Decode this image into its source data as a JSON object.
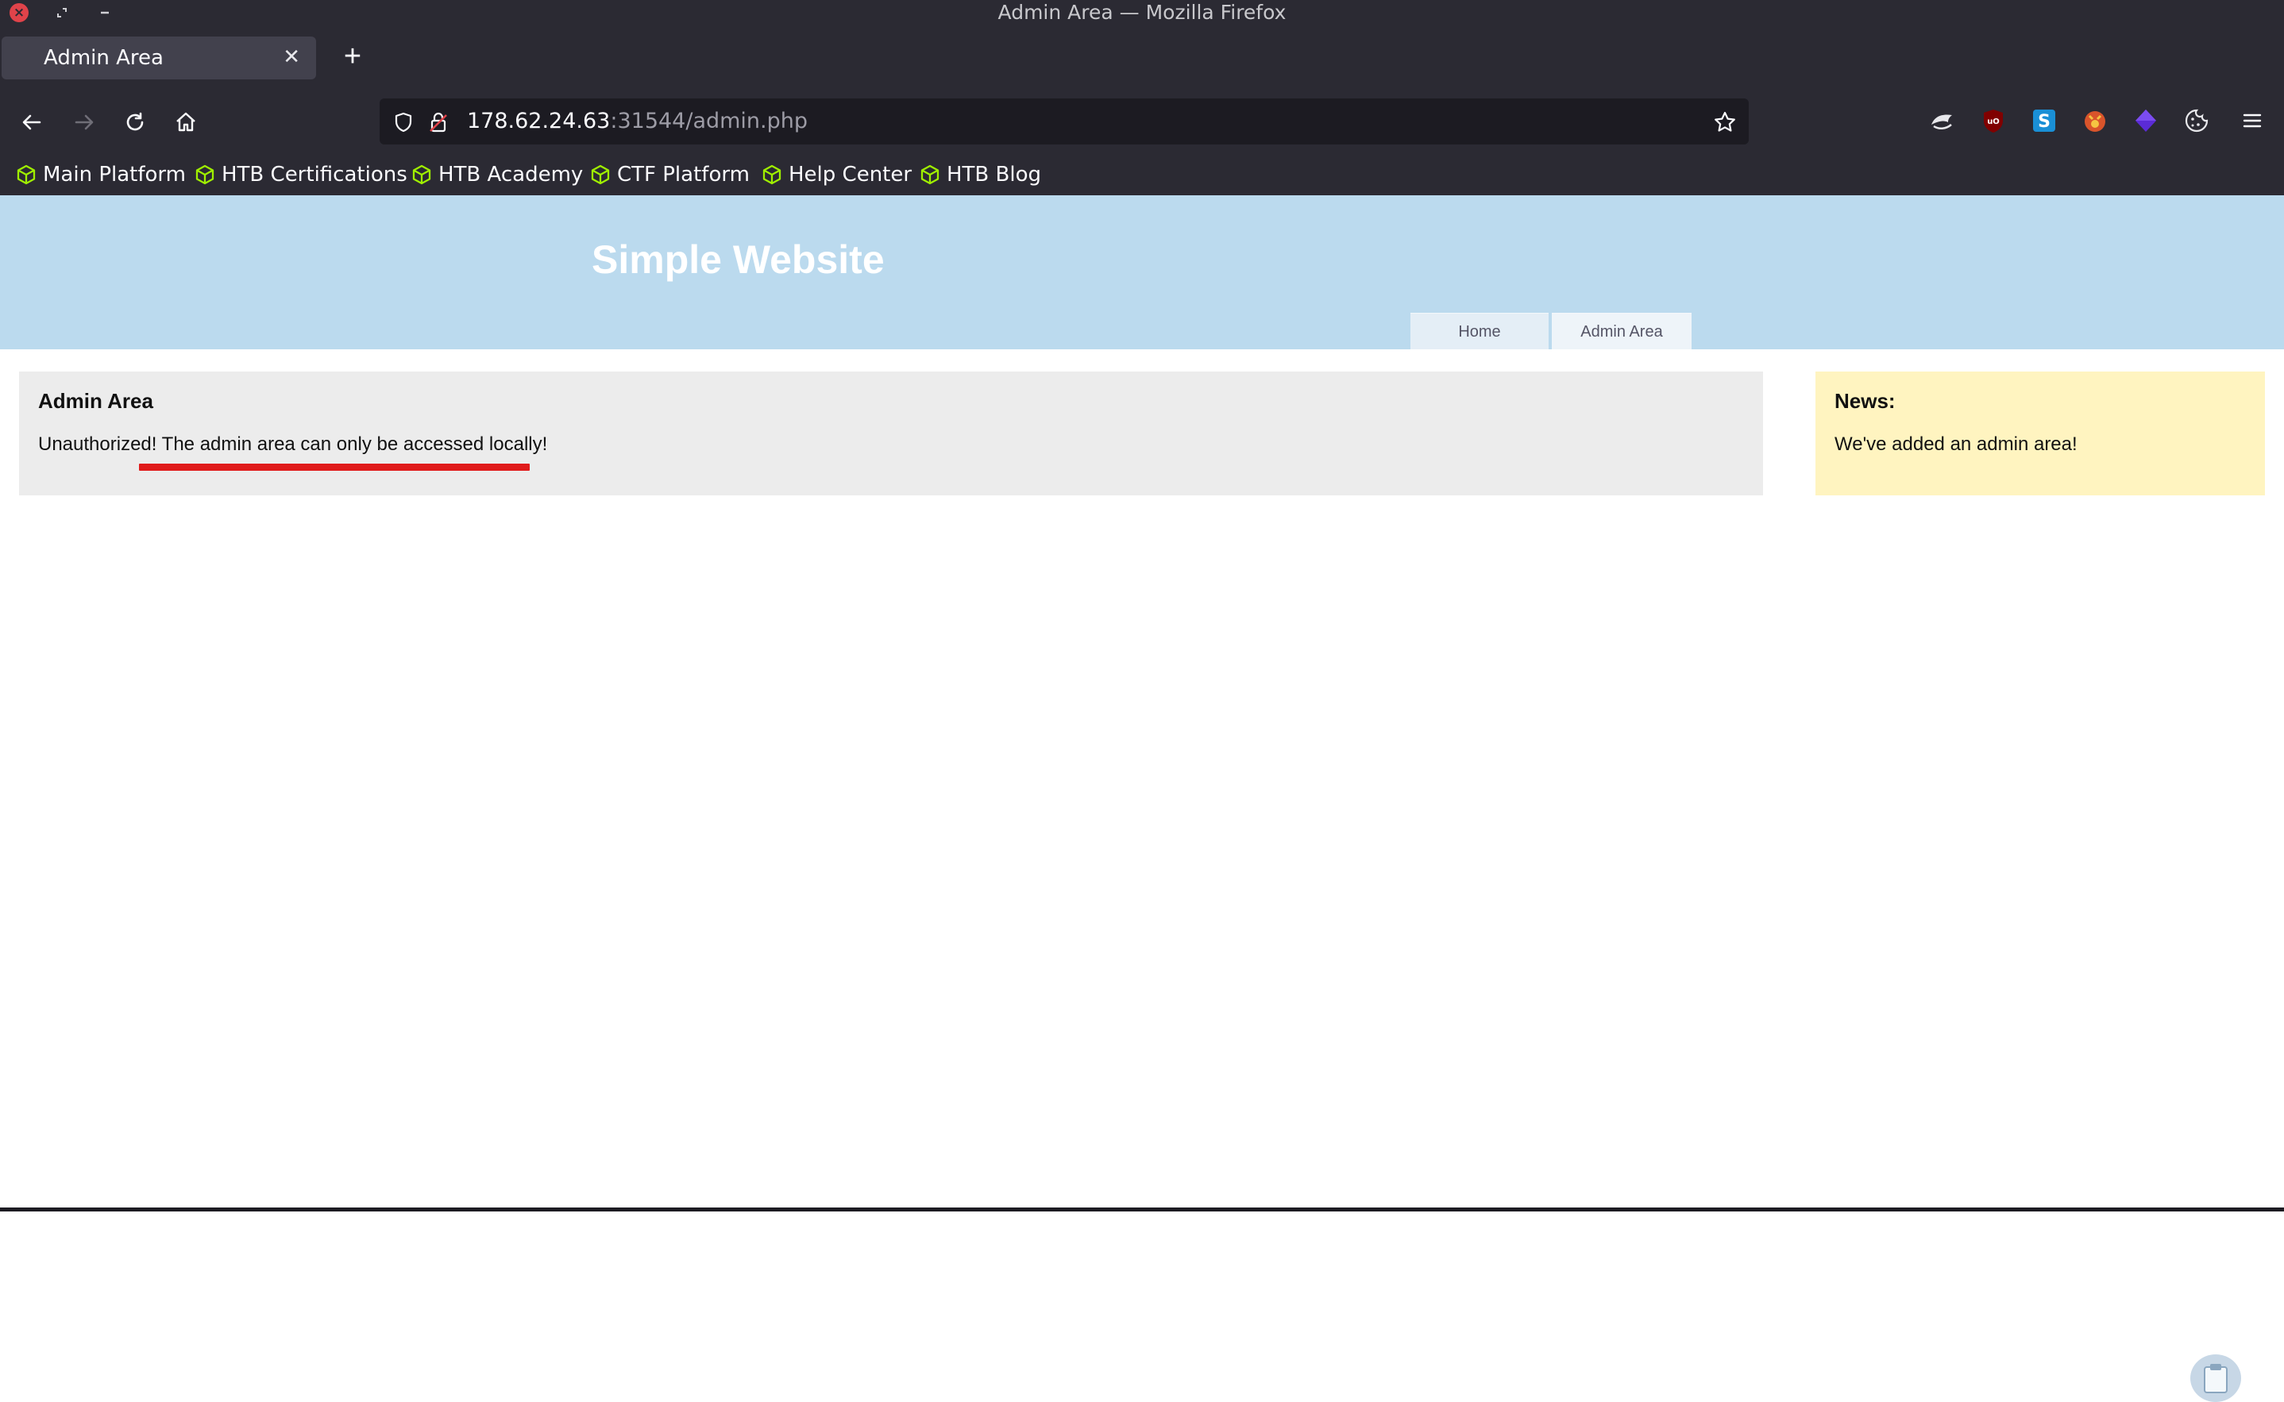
{
  "window": {
    "title": "Admin Area — Mozilla Firefox"
  },
  "tabs": [
    {
      "label": "Admin Area",
      "active": true
    }
  ],
  "urlbar": {
    "host": "178.62.24.63",
    "path": ":31544/admin.php"
  },
  "bookmarks": [
    {
      "label": "Main Platform",
      "icon": "htb-cube-icon"
    },
    {
      "label": "HTB Certifications",
      "icon": "htb-cube-icon"
    },
    {
      "label": "HTB Academy",
      "icon": "htb-cube-icon"
    },
    {
      "label": "CTF Platform",
      "icon": "htb-cube-icon"
    },
    {
      "label": "Help Center",
      "icon": "htb-cube-icon"
    },
    {
      "label": "HTB Blog",
      "icon": "htb-cube-icon"
    }
  ],
  "extensions": [
    "foxyproxy-icon",
    "ublock-origin-icon",
    "s-extension-icon",
    "wappalyzer-icon",
    "purple-cube-extension-icon",
    "cookie-icon"
  ],
  "site": {
    "title": "Simple Website",
    "nav": [
      "Home",
      "Admin Area"
    ]
  },
  "main": {
    "heading": "Admin Area",
    "message_prefix": "Unauthorized!",
    "message_highlight": "The admin area can only be accessed locally!"
  },
  "news": {
    "heading": "News:",
    "text": "We've added an admin area!"
  },
  "colors": {
    "chrome_bg": "#2b2a33",
    "urlbar_bg": "#1c1b22",
    "header_bg": "#bbdaee",
    "main_box_bg": "#ececec",
    "news_box_bg": "#fff4c0",
    "annotation_underline": "#e01b1b",
    "htb_green": "#9fef00"
  }
}
